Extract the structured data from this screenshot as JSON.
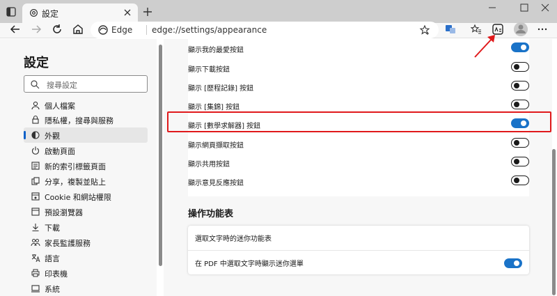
{
  "tab": {
    "title": "設定"
  },
  "address": {
    "brand": "Edge",
    "url": "edge://settings/appearance"
  },
  "sidebar": {
    "title": "設定",
    "search_placeholder": "搜尋設定",
    "items": [
      {
        "label": "個人檔案",
        "icon": "profile-icon"
      },
      {
        "label": "隱私權，搜尋與服務",
        "icon": "lock-icon"
      },
      {
        "label": "外觀",
        "icon": "appearance-icon",
        "active": true
      },
      {
        "label": "啟動頁面",
        "icon": "power-icon"
      },
      {
        "label": "新的索引標籤頁面",
        "icon": "newtab-icon"
      },
      {
        "label": "分享，複製並貼上",
        "icon": "share-icon"
      },
      {
        "label": "Cookie 和網站權限",
        "icon": "site-perms-icon"
      },
      {
        "label": "預設瀏覽器",
        "icon": "browser-icon"
      },
      {
        "label": "下載",
        "icon": "download-icon"
      },
      {
        "label": "家長監護服務",
        "icon": "family-icon"
      },
      {
        "label": "語言",
        "icon": "language-icon"
      },
      {
        "label": "印表機",
        "icon": "printer-icon"
      },
      {
        "label": "系統",
        "icon": "system-icon"
      }
    ]
  },
  "toolbar_buttons": {
    "rows": [
      {
        "label": "顯示我的最愛按鈕",
        "on": true
      },
      {
        "label": "顯示下載按鈕",
        "on": false
      },
      {
        "label": "顯示 [歷程記錄] 按鈕",
        "on": false
      },
      {
        "label": "顯示 [集錦] 按鈕",
        "on": false
      },
      {
        "label": "顯示 [數學求解器] 按鈕",
        "on": true
      },
      {
        "label": "顯示網頁擷取按鈕",
        "on": false
      },
      {
        "label": "顯示共用按鈕",
        "on": false
      },
      {
        "label": "顯示意見反應按鈕",
        "on": false
      }
    ]
  },
  "context_menu": {
    "title": "操作功能表",
    "rows": [
      {
        "label": "選取文字時的迷你功能表"
      },
      {
        "label": "在 PDF 中選取文字時顯示迷你選單",
        "on": true
      }
    ]
  },
  "colors": {
    "accent": "#1a73c8",
    "highlight": "#e0191b"
  }
}
